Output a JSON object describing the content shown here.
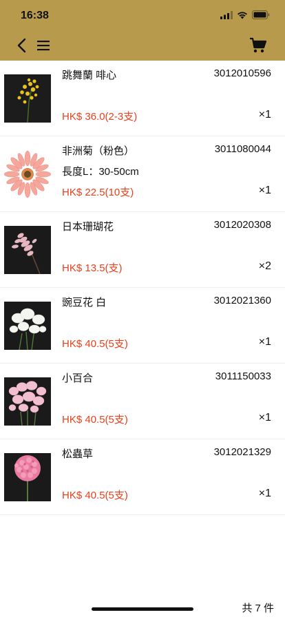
{
  "status_bar": {
    "time": "16:38"
  },
  "colors": {
    "header": "#b89a4c",
    "price": "#e8401c"
  },
  "nav": {
    "back_icon": "chevron-left-icon",
    "menu_icon": "hamburger-menu-icon",
    "cart_icon": "shopping-cart-icon"
  },
  "items": [
    {
      "name": "跳舞蘭 啡心",
      "code": "3012010596",
      "spec": "",
      "price": "HK$ 36.0(2-3支)",
      "qty": "×1",
      "image": "yellow-oncidium-orchid"
    },
    {
      "name": "非洲菊（粉色）",
      "code": "3011080044",
      "spec": "長度L：30-50cm",
      "price": "HK$ 22.5(10支)",
      "qty": "×1",
      "image": "pink-gerbera-daisy"
    },
    {
      "name": "日本珊瑚花",
      "code": "3012020308",
      "spec": "",
      "price": "HK$ 13.5(支)",
      "qty": "×2",
      "image": "pink-astilbe"
    },
    {
      "name": "豌豆花 白",
      "code": "3012021360",
      "spec": "",
      "price": "HK$ 40.5(5支)",
      "qty": "×1",
      "image": "white-sweet-pea"
    },
    {
      "name": "小百合",
      "code": "3011150033",
      "spec": "",
      "price": "HK$ 40.5(5支)",
      "qty": "×1",
      "image": "pink-sweet-pea"
    },
    {
      "name": "松蟲草",
      "code": "3012021329",
      "spec": "",
      "price": "HK$ 40.5(5支)",
      "qty": "×1",
      "image": "pink-scabiosa"
    }
  ],
  "footer": {
    "total": "共 7 件"
  }
}
